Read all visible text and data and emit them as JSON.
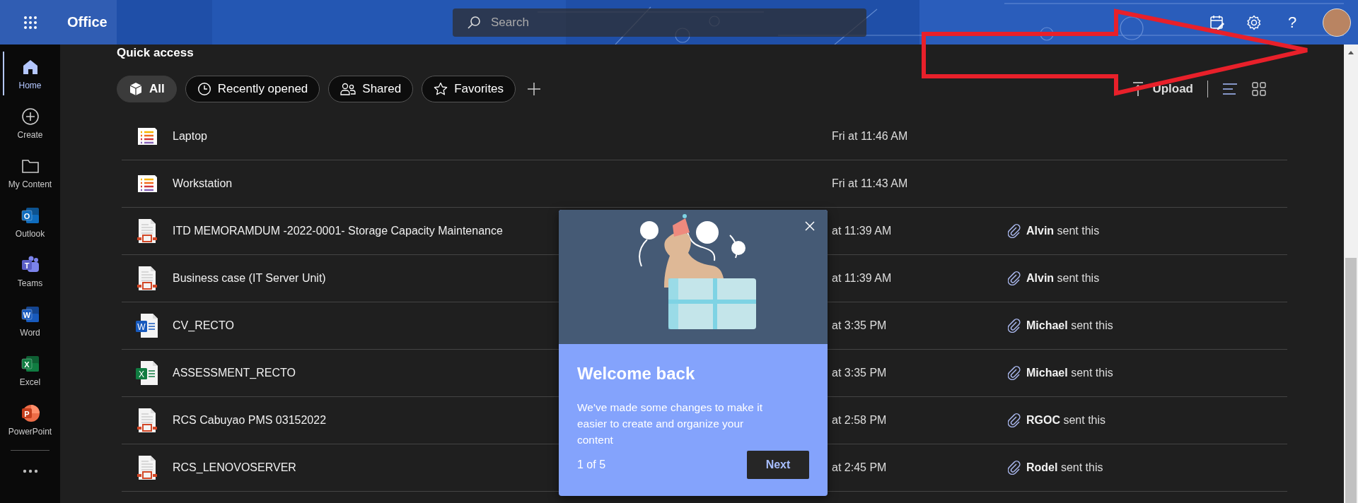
{
  "header": {
    "app_name": "Office",
    "search": {
      "placeholder": "Search"
    },
    "help": "?"
  },
  "sidebar": {
    "items": [
      {
        "label": "Home",
        "kind": "home",
        "selected": true
      },
      {
        "label": "Create",
        "kind": "create",
        "selected": false
      },
      {
        "label": "My Content",
        "kind": "folder",
        "selected": false
      },
      {
        "label": "Outlook",
        "kind": "outlook",
        "icon_letter": "O",
        "selected": false
      },
      {
        "label": "Teams",
        "kind": "teams",
        "icon_letter": "T",
        "selected": false
      },
      {
        "label": "Word",
        "kind": "word",
        "icon_letter": "W",
        "selected": false
      },
      {
        "label": "Excel",
        "kind": "excel",
        "icon_letter": "X",
        "selected": false
      },
      {
        "label": "PowerPoint",
        "kind": "powerpoint",
        "icon_letter": "P",
        "selected": false
      }
    ]
  },
  "section_title": "Quick access",
  "filters": [
    {
      "label": "All",
      "kind": "all",
      "selected": true
    },
    {
      "label": "Recently opened",
      "kind": "recent",
      "selected": false
    },
    {
      "label": "Shared",
      "kind": "shared",
      "selected": false
    },
    {
      "label": "Favorites",
      "kind": "favorites",
      "selected": false
    }
  ],
  "toolbar": {
    "upload": "Upload",
    "views": [
      {
        "kind": "list",
        "selected": true
      },
      {
        "kind": "grid",
        "selected": false
      }
    ]
  },
  "files": [
    {
      "name": "Laptop",
      "kind": "list",
      "modified": "Fri at 11:46 AM"
    },
    {
      "name": "Workstation",
      "kind": "list",
      "modified": "Fri at 11:43 AM"
    },
    {
      "name": "ITD MEMORAMDUM -2022-0001- Storage Capacity Maintenance",
      "kind": "document",
      "modified": "at 11:39 AM",
      "activity": "**Alvin** sent this"
    },
    {
      "name": "Business case (IT Server Unit)",
      "kind": "document",
      "modified": "at 11:39 AM",
      "activity": "**Alvin** sent this"
    },
    {
      "name": "CV_RECTO",
      "kind": "word",
      "icon_letter": "W",
      "modified": "at 3:35 PM",
      "activity": "**Michael** sent this"
    },
    {
      "name": "ASSESSMENT_RECTO",
      "kind": "excel",
      "icon_letter": "X",
      "modified": "at 3:35 PM",
      "activity": "**Michael** sent this"
    },
    {
      "name": "RCS Cabuyao PMS 03152022",
      "kind": "document",
      "modified": "at 2:58 PM",
      "activity": "**RGOC** sent this"
    },
    {
      "name": "RCS_LENOVOSERVER",
      "kind": "document",
      "modified": "at 2:45 PM",
      "activity": "**Rodel** sent this"
    }
  ],
  "popup": {
    "title": "Welcome back",
    "body": "We've made some changes to make it easier to create and organize your content",
    "progress": "1 of 5",
    "next": "Next"
  }
}
